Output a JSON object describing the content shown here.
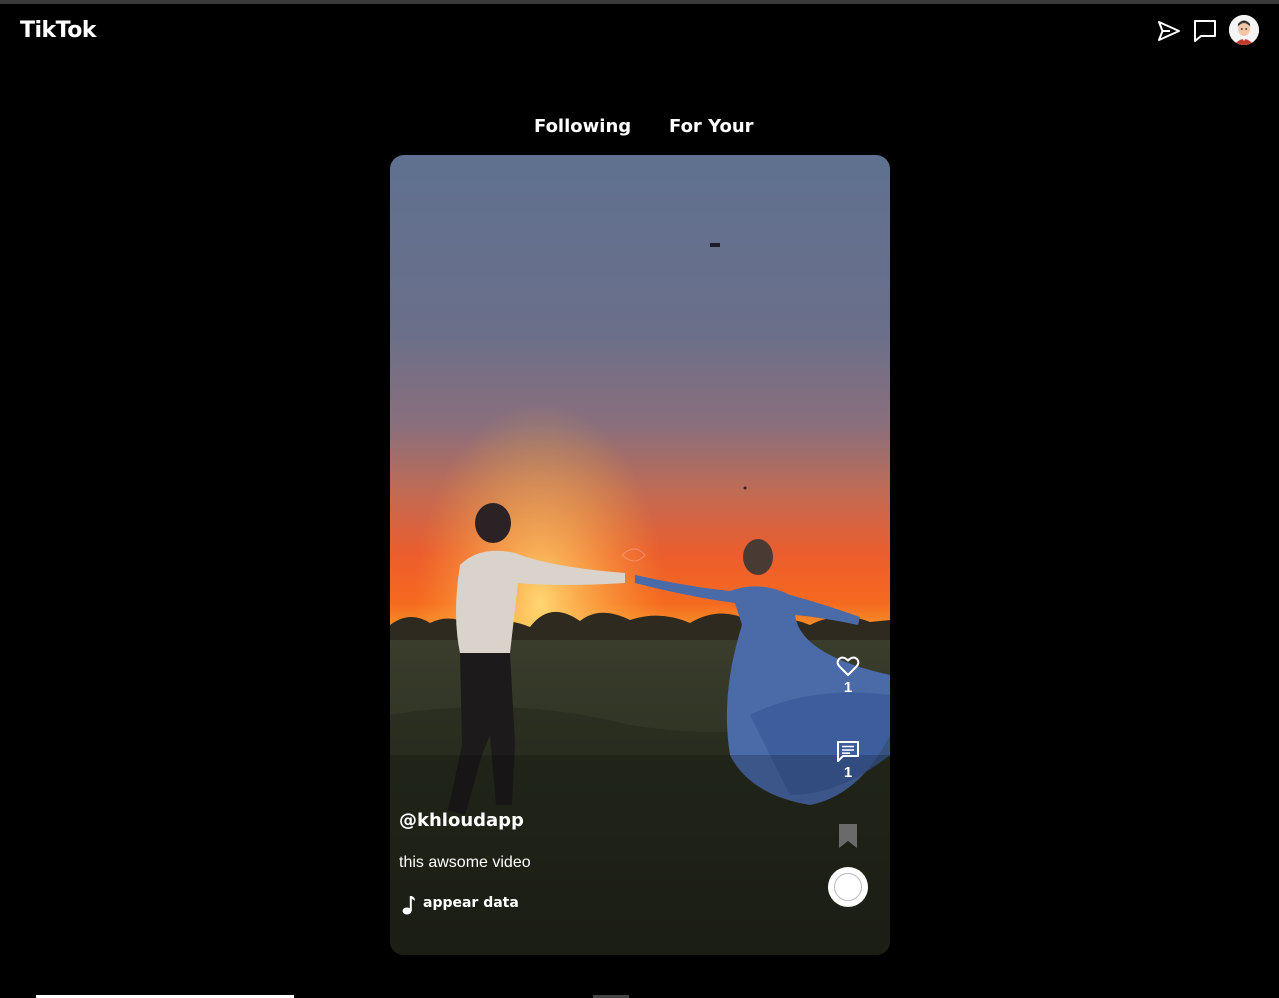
{
  "header": {
    "logo": "TikTok",
    "icons": [
      "send-icon",
      "message-icon",
      "avatar"
    ]
  },
  "tabs": [
    {
      "label": "Following"
    },
    {
      "label": "For Your"
    }
  ],
  "post": {
    "username": "@khloudapp",
    "caption": "this awsome video",
    "music": "appear data",
    "likes": "1",
    "comments": "1"
  },
  "colors": {
    "background": "#000000",
    "text": "#ffffff",
    "sky_top": "#5f7190",
    "sunset": "#f05a25"
  }
}
